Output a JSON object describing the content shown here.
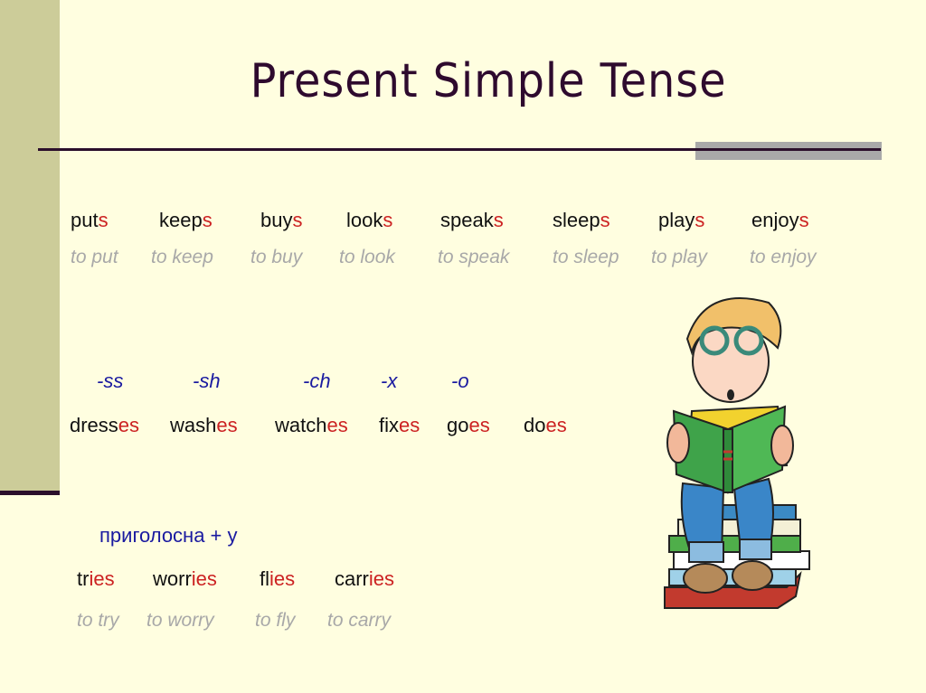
{
  "slide": {
    "title": "Present Simple Tense",
    "colors": {
      "background": "#fffee0",
      "side_bar": "#cccc99",
      "title": "#2e0a2e",
      "ending": "#cc2222",
      "infinitive": "#a8a8a8",
      "rule_label": "#1a1aa0"
    }
  },
  "group_s": {
    "words": [
      {
        "stem": "put",
        "ending": "s",
        "infinitive": "to put"
      },
      {
        "stem": "keep",
        "ending": "s",
        "infinitive": "to keep"
      },
      {
        "stem": "buy",
        "ending": "s",
        "infinitive": "to buy"
      },
      {
        "stem": "look",
        "ending": "s",
        "infinitive": "to look"
      },
      {
        "stem": "speak",
        "ending": "s",
        "infinitive": "to speak"
      },
      {
        "stem": "sleep",
        "ending": "s",
        "infinitive": "to sleep"
      },
      {
        "stem": "play",
        "ending": "s",
        "infinitive": "to play"
      },
      {
        "stem": "enjoy",
        "ending": "s",
        "infinitive": "to enjoy"
      }
    ]
  },
  "group_es": {
    "rules": [
      "-ss",
      "-sh",
      "-ch",
      "-x",
      "-o"
    ],
    "words": [
      {
        "stem": "dress",
        "ending": "es"
      },
      {
        "stem": "wash",
        "ending": "es"
      },
      {
        "stem": "watch",
        "ending": "es"
      },
      {
        "stem": "fix",
        "ending": "es"
      },
      {
        "stem": "go",
        "ending": "es"
      },
      {
        "stem": "do",
        "ending": "es"
      }
    ]
  },
  "group_ies": {
    "rule": "приголосна + y",
    "words": [
      {
        "stem": "tr",
        "ending": "ies",
        "infinitive": "to try"
      },
      {
        "stem": "worr",
        "ending": "ies",
        "infinitive": "to worry"
      },
      {
        "stem": "fl",
        "ending": "ies",
        "infinitive": "to fly"
      },
      {
        "stem": "carr",
        "ending": "ies",
        "infinitive": "to carry"
      }
    ]
  },
  "illustration": {
    "icon": "boy-reading-book-icon",
    "description": "Cartoon boy with glasses reading a green book while sitting on a stack of books"
  }
}
